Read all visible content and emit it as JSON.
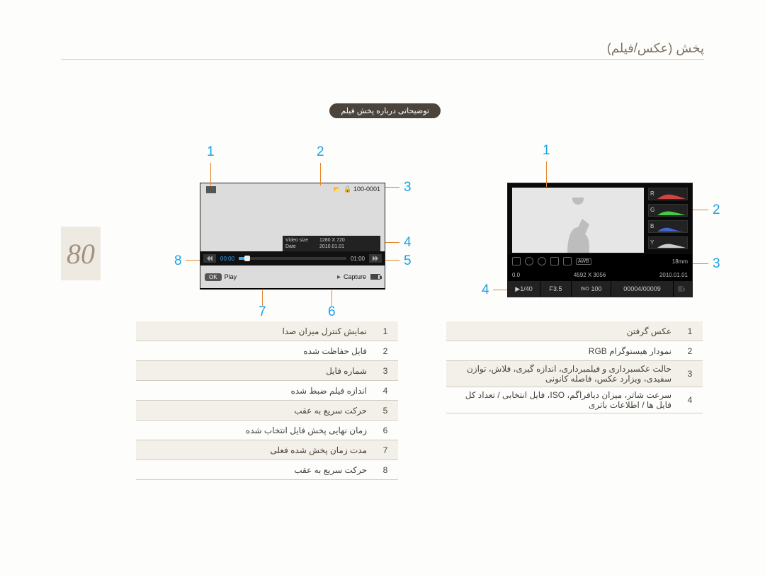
{
  "page_title": "پخش (عکس/فیلم)",
  "page_number": "80",
  "band_title": "توضیحاتی درباره پخش فیلم",
  "movie": {
    "file_number": "100-0001",
    "video_size_label": "Video size",
    "video_size": "1280 X 720",
    "date_label": "Date",
    "date": "2010.01.01",
    "time_elapsed": "00:00",
    "time_total": "01:00",
    "ok": "OK",
    "play": "Play",
    "capture": "Capture"
  },
  "left_callouts": [
    "1",
    "2",
    "3",
    "4",
    "5",
    "6",
    "7",
    "8"
  ],
  "left_table": [
    {
      "n": "1",
      "t": "نمایش کنترل میزان صدا"
    },
    {
      "n": "2",
      "t": "فایل حفاظت شده"
    },
    {
      "n": "3",
      "t": "شماره فایل"
    },
    {
      "n": "4",
      "t": "اندازه فیلم ضبط شده"
    },
    {
      "n": "5",
      "t": "حرکت سریع به عقب"
    },
    {
      "n": "6",
      "t": "زمان نهایی پخش فایل انتخاب شده"
    },
    {
      "n": "7",
      "t": "مدت زمان پخش شده فعلی"
    },
    {
      "n": "8",
      "t": "حرکت سریع به عقب"
    }
  ],
  "photo": {
    "histogram_channels": [
      "R",
      "G",
      "B",
      "Y"
    ],
    "awb": "AWB",
    "focal": "18mm",
    "ev": "0.0",
    "resolution": "4592 X 3056",
    "date": "2010.01.01",
    "index": "1/40",
    "aperture": "F3.5",
    "iso_label": "ISO",
    "iso": "100",
    "counter": "00004/00009"
  },
  "right_callouts": [
    "1",
    "2",
    "3",
    "4"
  ],
  "right_table": [
    {
      "n": "1",
      "t": "عکس گرفتن"
    },
    {
      "n": "2",
      "t": "نمودار هیستوگرام RGB"
    },
    {
      "n": "3",
      "t": "حالت عکسبرداری و فیلمبرداری، اندازه گیری، فلاش، توازن سفیدی، ویزارد عکس، فاصله کانونی"
    },
    {
      "n": "4",
      "t": "سرعت شاتر، میزان دیافراگم، ISO، فایل انتخابی / تعداد کل فایل ها / اطلاعات باتری"
    }
  ]
}
